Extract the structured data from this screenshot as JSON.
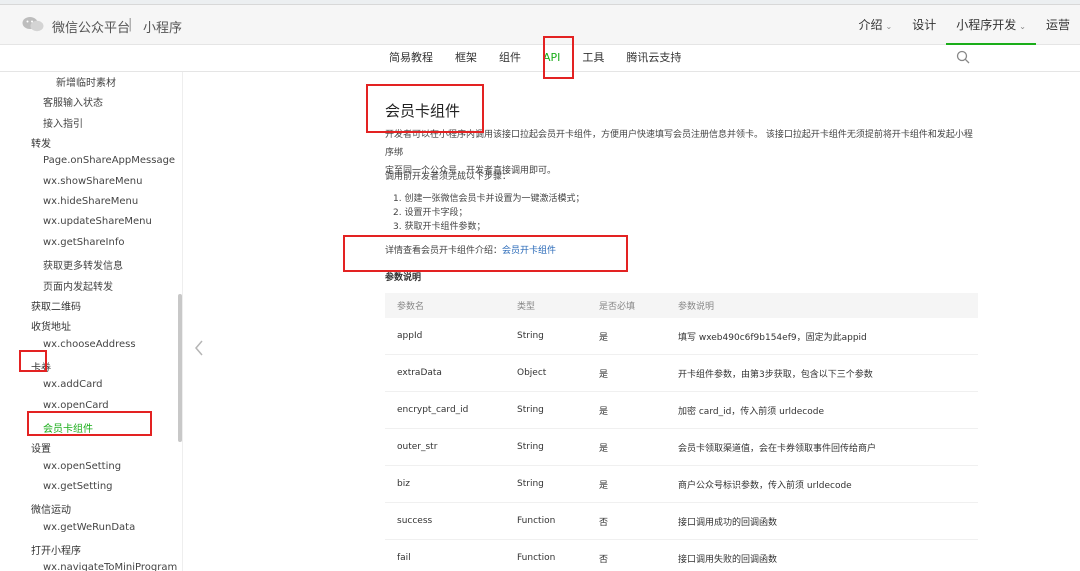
{
  "topbar": {
    "brand": "微信公众平台",
    "separator": "|",
    "section": "小程序",
    "nav": [
      {
        "label": "介绍",
        "arrow": true,
        "active": false
      },
      {
        "label": "设计",
        "arrow": false,
        "active": false
      },
      {
        "label": "小程序开发",
        "arrow": true,
        "active": true
      },
      {
        "label": "运营",
        "arrow": false,
        "active": false
      }
    ]
  },
  "subnav": {
    "items": [
      {
        "label": "简易教程",
        "active": false
      },
      {
        "label": "框架",
        "active": false
      },
      {
        "label": "组件",
        "active": false
      },
      {
        "label": "API",
        "active": true
      },
      {
        "label": "工具",
        "active": false
      },
      {
        "label": "腾讯云支持",
        "active": false
      }
    ]
  },
  "sidebar": {
    "items": [
      {
        "label": "新增临时素材",
        "level": 3,
        "active": false
      },
      {
        "label": "客服输入状态",
        "level": 2,
        "active": false
      },
      {
        "label": "接入指引",
        "level": 2,
        "active": false
      },
      {
        "label": "转发",
        "level": 1,
        "active": false
      },
      {
        "label": "Page.onShareAppMessage",
        "level": 2,
        "active": false
      },
      {
        "label": "wx.showShareMenu",
        "level": 2,
        "active": false
      },
      {
        "label": "wx.hideShareMenu",
        "level": 2,
        "active": false
      },
      {
        "label": "wx.updateShareMenu",
        "level": 2,
        "active": false
      },
      {
        "label": "wx.getShareInfo",
        "level": 2,
        "active": false
      },
      {
        "label": "获取更多转发信息",
        "level": 2,
        "active": false
      },
      {
        "label": "页面内发起转发",
        "level": 2,
        "active": false
      },
      {
        "label": "获取二维码",
        "level": 1,
        "active": false
      },
      {
        "label": "收货地址",
        "level": 1,
        "active": false
      },
      {
        "label": "wx.chooseAddress",
        "level": 2,
        "active": false
      },
      {
        "label": "卡券",
        "level": 1,
        "active": false
      },
      {
        "label": "wx.addCard",
        "level": 2,
        "active": false
      },
      {
        "label": "wx.openCard",
        "level": 2,
        "active": false
      },
      {
        "label": "会员卡组件",
        "level": 2,
        "active": true
      },
      {
        "label": "设置",
        "level": 1,
        "active": false
      },
      {
        "label": "wx.openSetting",
        "level": 2,
        "active": false
      },
      {
        "label": "wx.getSetting",
        "level": 2,
        "active": false
      },
      {
        "label": "微信运动",
        "level": 1,
        "active": false
      },
      {
        "label": "wx.getWeRunData",
        "level": 2,
        "active": false
      },
      {
        "label": "打开小程序",
        "level": 1,
        "active": false
      },
      {
        "label": "wx.navigateToMiniProgram",
        "level": 2,
        "active": false
      }
    ]
  },
  "content": {
    "title": "会员卡组件",
    "intro_line1": "开发者可以在小程序内调用该接口拉起会员开卡组件，方便用户快速填写会员注册信息并领卡。 该接口拉起开卡组件无须提前将开卡组件和发起小程序绑",
    "intro_line2": "定至同一个公众号，开发者直接调用即可。",
    "steps_intro": "调用前开发者须完成以下步骤：",
    "steps": [
      "1. 创建一张微信会员卡并设置为一键激活模式；",
      "2. 设置开卡字段；",
      "3. 获取开卡组件参数；"
    ],
    "detail_prefix": "详情查看会员开卡组件介绍：",
    "detail_link": "会员开卡组件",
    "params_title": "参数说明",
    "params_headers": [
      "参数名",
      "类型",
      "是否必填",
      "参数说明"
    ],
    "params_rows": [
      [
        "appId",
        "String",
        "是",
        "填写 wxeb490c6f9b154ef9，固定为此appid"
      ],
      [
        "extraData",
        "Object",
        "是",
        "开卡组件参数，由第3步获取，包含以下三个参数"
      ],
      [
        "encrypt_card_id",
        "String",
        "是",
        "加密 card_id，传入前须 urldecode"
      ],
      [
        "outer_str",
        "String",
        "是",
        "会员卡领取渠道值，会在卡券领取事件回传给商户"
      ],
      [
        "biz",
        "String",
        "是",
        "商户公众号标识参数，传入前须 urldecode"
      ],
      [
        "success",
        "Function",
        "否",
        "接口调用成功的回调函数"
      ],
      [
        "fail",
        "Function",
        "否",
        "接口调用失败的回调函数"
      ]
    ]
  },
  "colors": {
    "accent": "#1aad19",
    "highlight": "#e32222",
    "link": "#2a6ab8"
  }
}
